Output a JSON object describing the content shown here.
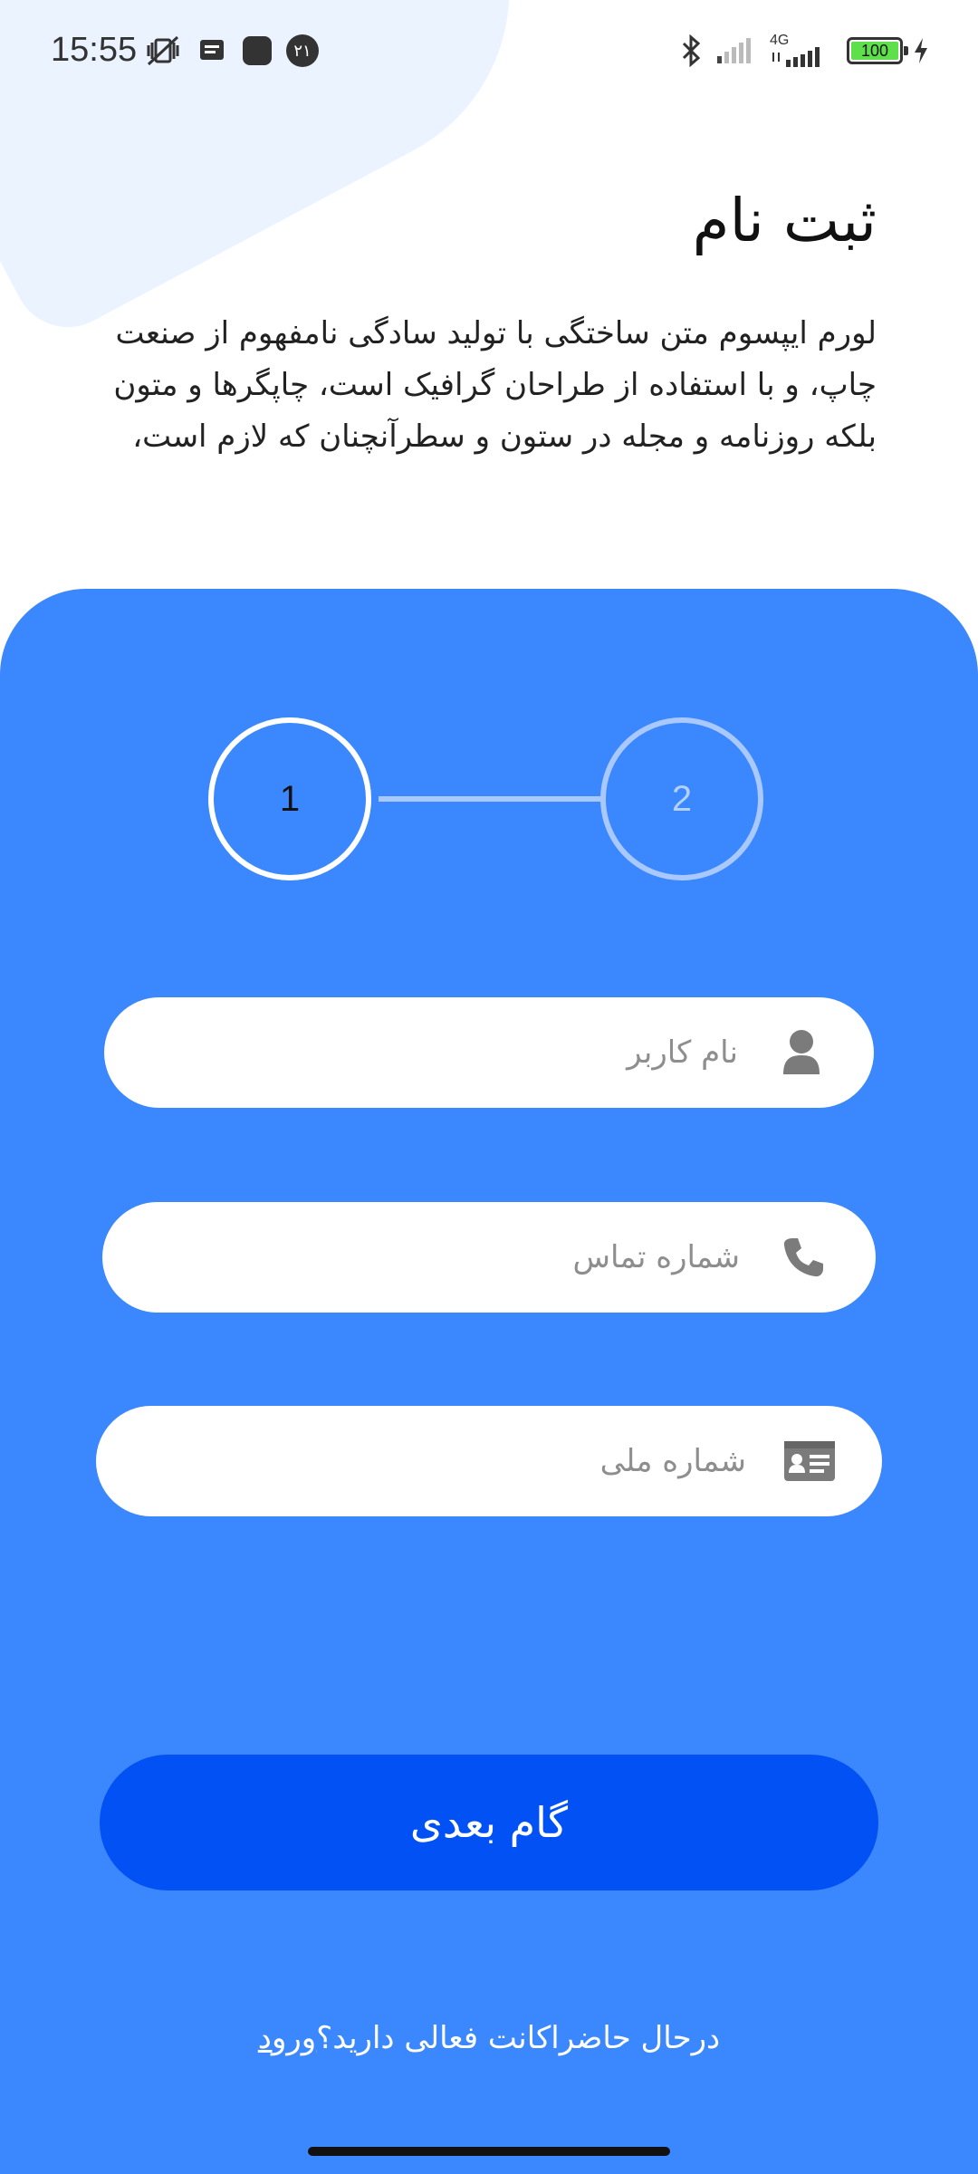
{
  "status_bar": {
    "time": "15:55",
    "notification_badge": "۲۱",
    "network_type": "4G",
    "battery_level": "100",
    "icons": [
      "mute-vibrate-icon",
      "message-icon",
      "app-icon",
      "bluetooth-icon",
      "signal-icon",
      "signal-4g-icon",
      "battery-icon",
      "charging-icon"
    ]
  },
  "header": {
    "title": "ثبت نام",
    "description": "لورم ایپسوم متن ساختگی با تولید سادگی نامفهوم از صنعت چاپ، و با استفاده از طراحان گرافیک است، چاپگرها و متون بلکه روزنامه و مجله در ستون و سطرآنچنان که لازم است،"
  },
  "stepper": {
    "steps": [
      {
        "label": "1",
        "active": true
      },
      {
        "label": "2",
        "active": false
      }
    ]
  },
  "form": {
    "username": {
      "placeholder": "نام کاربر",
      "value": "",
      "icon": "user-icon"
    },
    "phone": {
      "placeholder": "شماره تماس",
      "value": "",
      "icon": "phone-icon"
    },
    "national_id": {
      "placeholder": "شماره ملی",
      "value": "",
      "icon": "id-card-icon"
    }
  },
  "next_button_label": "گام بعدی",
  "login": {
    "prompt": "درحال حاضراکانت فعالی دارید؟",
    "link_label": "ورود"
  },
  "colors": {
    "card": "#3b87fd",
    "button": "#0251f5",
    "background": "#ffffff",
    "accent_light": "#eaf3ff"
  }
}
